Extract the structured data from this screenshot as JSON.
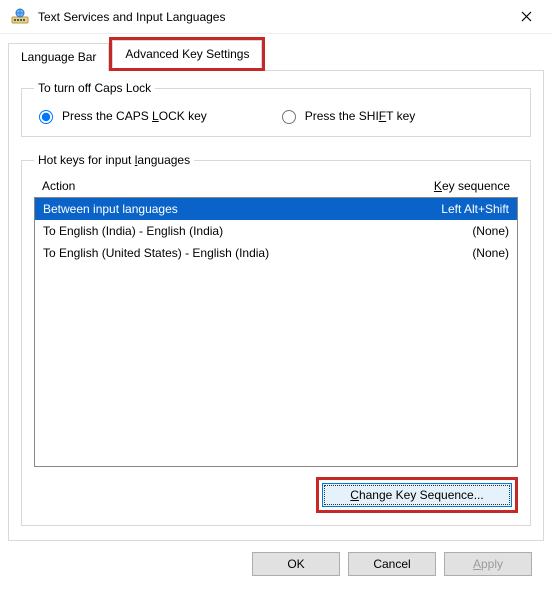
{
  "window": {
    "title": "Text Services and Input Languages"
  },
  "tabs": {
    "language_bar": "Language Bar",
    "advanced_key": "Advanced Key Settings"
  },
  "capslock_group": {
    "legend": "To turn off Caps Lock",
    "press_capslock_pre": "Press the CAPS ",
    "press_capslock_ul": "L",
    "press_capslock_post": "OCK key",
    "press_shift_pre": "Press the SHI",
    "press_shift_ul": "F",
    "press_shift_post": "T key"
  },
  "hotkeys": {
    "legend_pre": "Hot keys for input ",
    "legend_ul": "l",
    "legend_post": "anguages",
    "header_action": "Action",
    "header_keyseq_ul": "K",
    "header_keyseq_post": "ey sequence",
    "rows": [
      {
        "action": "Between input languages",
        "keyseq": "Left Alt+Shift"
      },
      {
        "action": "To English (India) - English (India)",
        "keyseq": "(None)"
      },
      {
        "action": "To English (United States) - English (India)",
        "keyseq": "(None)"
      }
    ],
    "change_ul": "C",
    "change_post": "hange Key Sequence..."
  },
  "buttons": {
    "ok": "OK",
    "cancel": "Cancel",
    "apply_ul": "A",
    "apply_post": "pply"
  }
}
